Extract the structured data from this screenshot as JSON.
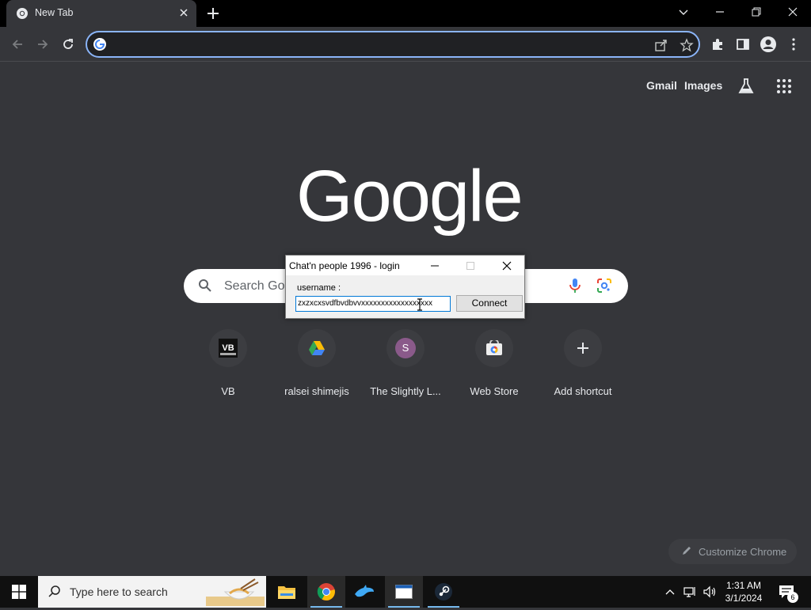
{
  "browser": {
    "tab_title": "New Tab",
    "omnibox_value": "",
    "top_links": {
      "gmail": "Gmail",
      "images": "Images"
    }
  },
  "ntp": {
    "logo_text": "Google",
    "search_placeholder": "Search Google or type a URL",
    "shortcuts": [
      {
        "label": "VB",
        "icon": "vb-icon"
      },
      {
        "label": "ralsei shimejis",
        "icon": "google-drive-icon"
      },
      {
        "label": "The Slightly L...",
        "icon": "letter-s-icon",
        "letter": "S"
      },
      {
        "label": "Web Store",
        "icon": "web-store-icon"
      },
      {
        "label": "Add shortcut",
        "icon": "plus-icon"
      }
    ],
    "customize_label": "Customize Chrome"
  },
  "dialog": {
    "title": "Chat'n people 1996 - login",
    "username_label": "username :",
    "username_value": "zxzxcxsvdfbvdbvvxxxxxxxxxxxxxxxxxx",
    "connect_label": "Connect"
  },
  "taskbar": {
    "search_placeholder": "Type here to search",
    "time": "1:31 AM",
    "date": "3/1/2024",
    "notification_count": "6"
  },
  "colors": {
    "accent": "#8ab4f8",
    "background": "#35363a"
  }
}
